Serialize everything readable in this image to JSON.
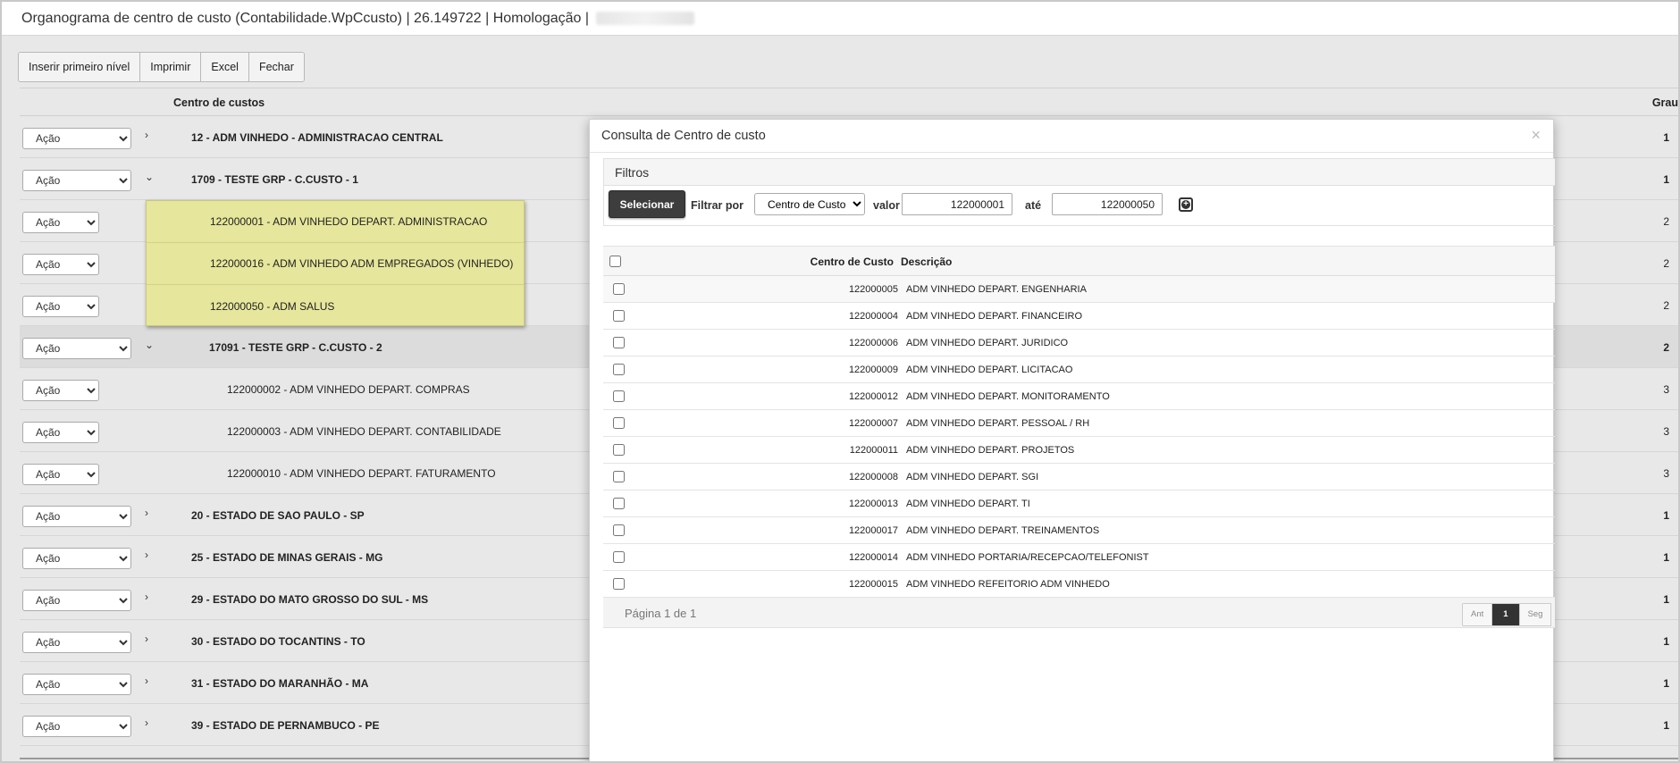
{
  "window": {
    "title": "Organograma de centro de custo (Contabilidade.WpCcusto) | 26.149722 | Homologação |"
  },
  "toolbar": {
    "insert_label": "Inserir primeiro nível",
    "print_label": "Imprimir",
    "excel_label": "Excel",
    "close_label": "Fechar"
  },
  "tree": {
    "header_centro": "Centro de custos",
    "header_grau": "Grau",
    "action_label": "Ação",
    "rows": [
      {
        "label": "12 - ADM VINHEDO - ADMINISTRACAO CENTRAL",
        "grau": "1"
      },
      {
        "label": "1709 - TESTE GRP - C.CUSTO - 1",
        "grau": "1"
      },
      {
        "label": "",
        "grau": "2"
      },
      {
        "label": "",
        "grau": "2"
      },
      {
        "label": "",
        "grau": "2"
      },
      {
        "label": "17091 - TESTE GRP - C.CUSTO - 2",
        "grau": "2"
      },
      {
        "label": "122000002 - ADM VINHEDO DEPART. COMPRAS",
        "grau": "3"
      },
      {
        "label": "122000003 - ADM VINHEDO DEPART. CONTABILIDADE",
        "grau": "3"
      },
      {
        "label": "122000010 - ADM VINHEDO DEPART. FATURAMENTO",
        "grau": "3"
      },
      {
        "label": "20 - ESTADO DE SAO PAULO - SP",
        "grau": "1"
      },
      {
        "label": "25 - ESTADO DE MINAS GERAIS - MG",
        "grau": "1"
      },
      {
        "label": "29 - ESTADO DO MATO GROSSO DO SUL - MS",
        "grau": "1"
      },
      {
        "label": "30 - ESTADO DO TOCANTINS - TO",
        "grau": "1"
      },
      {
        "label": "31 - ESTADO DO MARANHÃO - MA",
        "grau": "1"
      },
      {
        "label": "39 - ESTADO DE PERNAMBUCO - PE",
        "grau": "1"
      }
    ],
    "tooltip_items": [
      "122000001 - ADM VINHEDO DEPART. ADMINISTRACAO",
      "122000016 - ADM VINHEDO ADM EMPREGADOS (VINHEDO)",
      "122000050 - ADM SALUS"
    ]
  },
  "modal": {
    "title": "Consulta de Centro de custo",
    "close_glyph": "×",
    "filters": {
      "title": "Filtros",
      "select_button": "Selecionar",
      "filter_by_label": "Filtrar por",
      "filter_by_value": "Centro de Custo",
      "value_label": "valor",
      "value_from": "122000001",
      "until_label": "até",
      "value_to": "122000050"
    },
    "grid": {
      "col_code": "Centro de Custo",
      "col_desc": "Descrição",
      "rows": [
        {
          "code": "122000005",
          "desc": "ADM VINHEDO DEPART. ENGENHARIA"
        },
        {
          "code": "122000004",
          "desc": "ADM VINHEDO DEPART. FINANCEIRO"
        },
        {
          "code": "122000006",
          "desc": "ADM VINHEDO DEPART. JURIDICO"
        },
        {
          "code": "122000009",
          "desc": "ADM VINHEDO DEPART. LICITACAO"
        },
        {
          "code": "122000012",
          "desc": "ADM VINHEDO DEPART. MONITORAMENTO"
        },
        {
          "code": "122000007",
          "desc": "ADM VINHEDO DEPART. PESSOAL / RH"
        },
        {
          "code": "122000011",
          "desc": "ADM VINHEDO DEPART. PROJETOS"
        },
        {
          "code": "122000008",
          "desc": "ADM VINHEDO DEPART. SGI"
        },
        {
          "code": "122000013",
          "desc": "ADM VINHEDO DEPART. TI"
        },
        {
          "code": "122000017",
          "desc": "ADM VINHEDO DEPART. TREINAMENTOS"
        },
        {
          "code": "122000014",
          "desc": "ADM VINHEDO PORTARIA/RECEPCAO/TELEFONIST"
        },
        {
          "code": "122000015",
          "desc": "ADM VINHEDO REFEITORIO ADM VINHEDO"
        }
      ],
      "page_info": "Página 1 de 1",
      "pager_prev": "Ant",
      "pager_current": "1",
      "pager_next": "Seg"
    }
  }
}
